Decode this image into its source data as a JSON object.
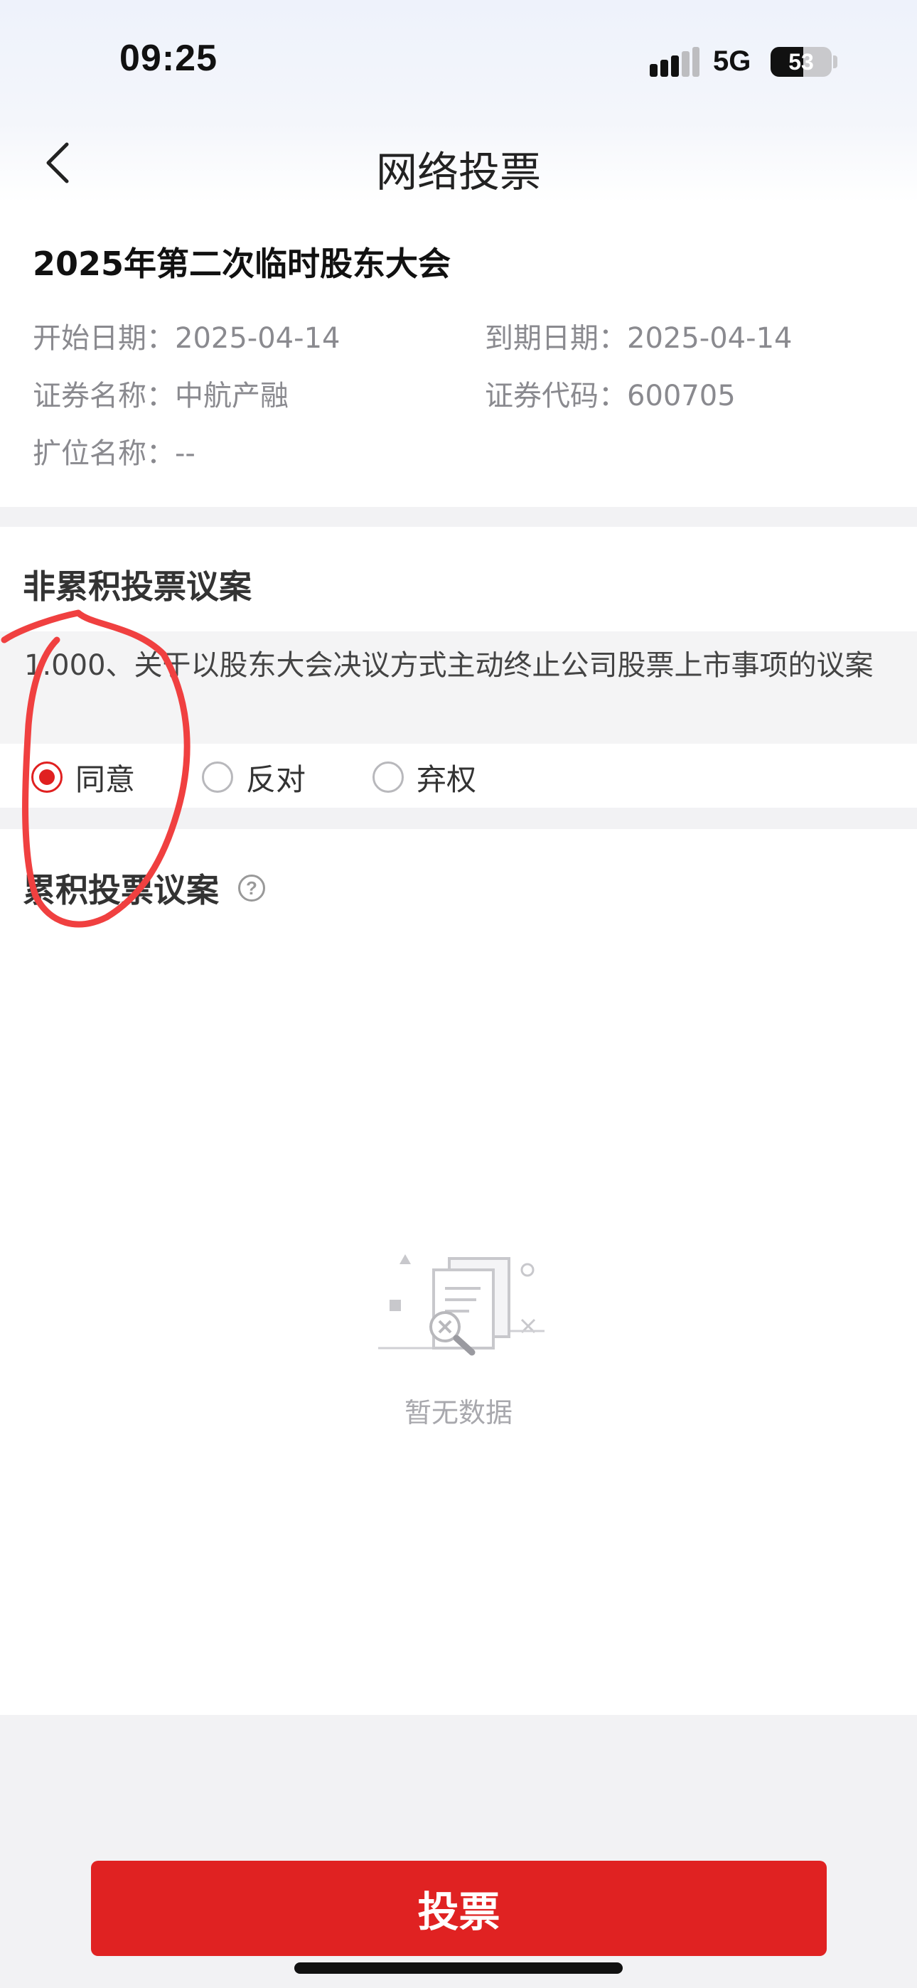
{
  "status_bar": {
    "time": "09:25",
    "network": "5G",
    "battery_level": "53"
  },
  "nav": {
    "title": "网络投票",
    "back_icon": "chevron-left-icon"
  },
  "meeting": {
    "title": "2025年第二次临时股东大会",
    "start_date_label": "开始日期：",
    "start_date": "2025-04-14",
    "end_date_label": "到期日期：",
    "end_date": "2025-04-14",
    "security_name_label": "证券名称：",
    "security_name": "中航产融",
    "security_code_label": "证券代码：",
    "security_code": "600705",
    "ext_name_label": "扩位名称：",
    "ext_name": "--"
  },
  "non_cumulative": {
    "title": "非累积投票议案",
    "proposals": [
      {
        "text": "1.000、关于以股东大会决议方式主动终止公司股票上市事项的议案",
        "options": [
          "同意",
          "反对",
          "弃权"
        ],
        "selected": "同意"
      }
    ]
  },
  "cumulative": {
    "title": "累积投票议案",
    "help_icon": "question-circle-icon",
    "empty_text": "暂无数据"
  },
  "vote_button": "投票",
  "colors": {
    "accent": "#e02222",
    "annotation": "#f04040"
  }
}
